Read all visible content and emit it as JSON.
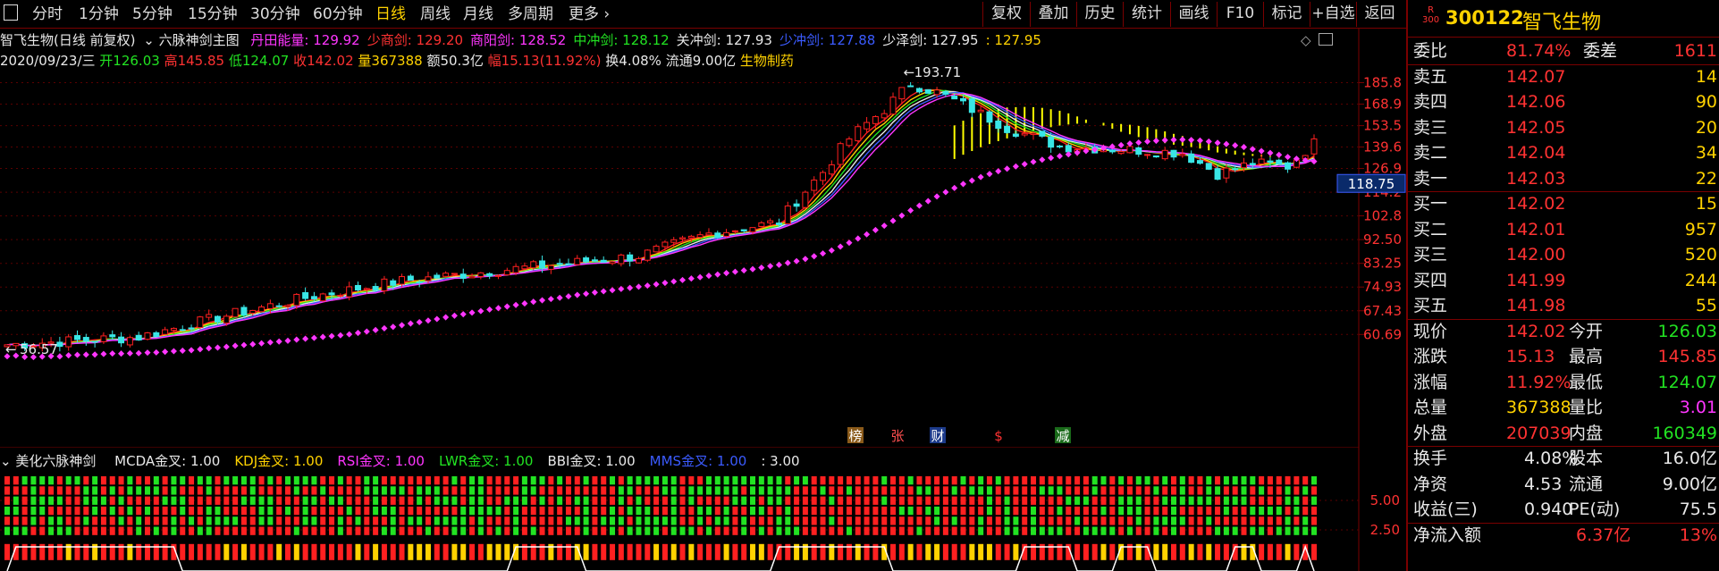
{
  "toolbar": {
    "periods": [
      "分时",
      "1分钟",
      "5分钟",
      "15分钟",
      "30分钟",
      "60分钟",
      "日线",
      "周线",
      "月线",
      "多周期",
      "更多"
    ],
    "active_period": "日线",
    "actions": [
      "复权",
      "叠加",
      "历史",
      "统计",
      "画线",
      "F10",
      "标记",
      "+自选",
      "返回"
    ]
  },
  "main_header": {
    "stock_title": "智飞生物(日线 前复权)",
    "indicator_name": "六脉神剑主图",
    "lines": [
      {
        "label": "丹田能量: 129.92",
        "color": "#ff36ff"
      },
      {
        "label": "少商剑: 129.20",
        "color": "#ff3232"
      },
      {
        "label": "商阳剑: 128.52",
        "color": "#ff36ff"
      },
      {
        "label": "中冲剑: 128.12",
        "color": "#22e322"
      },
      {
        "label": "关冲剑: 127.93",
        "color": "#e8e8e8"
      },
      {
        "label": "少冲剑: 127.88",
        "color": "#3b5bff"
      },
      {
        "label": "少泽剑: 127.95",
        "color": "#e8e8e8"
      },
      {
        "label": ": 127.95",
        "color": "#ffd200"
      }
    ],
    "date": "2020/09/23/三",
    "open": "开126.03",
    "high": "高145.85",
    "low": "低124.07",
    "close": "收142.02",
    "volume": "量367388",
    "amount": "额50.3亿",
    "change_pct": "幅15.13(11.92%)",
    "turnover": "换4.08%",
    "float_cap": "流通9.00亿",
    "industry": "生物制药"
  },
  "price_axis": {
    "labels": [
      "185.8",
      "168.9",
      "153.5",
      "139.6",
      "126.9",
      "114.2",
      "102.8",
      "92.50",
      "83.25",
      "74.93",
      "67.43",
      "60.69"
    ],
    "current_marker": "118.75"
  },
  "annotations": {
    "max_label": "193.71",
    "min_label": "56.57",
    "tags": [
      {
        "text": "榜",
        "bg": "#8a5a1a",
        "color": "#ffffff"
      },
      {
        "text": "张",
        "bg": "#000000",
        "color": "#ff5050"
      },
      {
        "text": "财",
        "bg": "#1c3a8a",
        "color": "#ffffff"
      },
      {
        "text": "$",
        "bg": "#000000",
        "color": "#ff3232"
      },
      {
        "text": "减",
        "bg": "#1a6a1a",
        "color": "#ffffff"
      }
    ]
  },
  "sub_header": {
    "name": "美化六脉神剑",
    "items": [
      {
        "label": "MCDA金叉: 1.00",
        "color": "#e8e8e8"
      },
      {
        "label": "KDJ金叉: 1.00",
        "color": "#ffd200"
      },
      {
        "label": "RSI金叉: 1.00",
        "color": "#ff36ff"
      },
      {
        "label": "LWR金叉: 1.00",
        "color": "#22e322"
      },
      {
        "label": "BBI金叉: 1.00",
        "color": "#e8e8e8"
      },
      {
        "label": "MMS金叉: 1.00",
        "color": "#3b5bff"
      },
      {
        "label": ": 3.00",
        "color": "#e8e8e8"
      }
    ],
    "axis_labels": [
      "5.00",
      "2.50"
    ]
  },
  "quote": {
    "badge": "R\n300",
    "code": "300122",
    "name": "智飞生物",
    "weibi_label": "委比",
    "weibi_value": "81.74%",
    "weicha_label": "委差",
    "weicha_value": "1611",
    "asks": [
      {
        "label": "卖五",
        "price": "142.07",
        "vol": "14"
      },
      {
        "label": "卖四",
        "price": "142.06",
        "vol": "90"
      },
      {
        "label": "卖三",
        "price": "142.05",
        "vol": "20"
      },
      {
        "label": "卖二",
        "price": "142.04",
        "vol": "34"
      },
      {
        "label": "卖一",
        "price": "142.03",
        "vol": "22"
      }
    ],
    "bids": [
      {
        "label": "买一",
        "price": "142.02",
        "vol": "15"
      },
      {
        "label": "买二",
        "price": "142.01",
        "vol": "957"
      },
      {
        "label": "买三",
        "price": "142.00",
        "vol": "520"
      },
      {
        "label": "买四",
        "price": "141.99",
        "vol": "244"
      },
      {
        "label": "买五",
        "price": "141.98",
        "vol": "55"
      }
    ],
    "stats": [
      {
        "l1": "现价",
        "v1": "142.02",
        "c1": "#ff3232",
        "l2": "今开",
        "v2": "126.03",
        "c2": "#22e322"
      },
      {
        "l1": "涨跌",
        "v1": "15.13",
        "c1": "#ff3232",
        "l2": "最高",
        "v2": "145.85",
        "c2": "#ff3232"
      },
      {
        "l1": "涨幅",
        "v1": "11.92%",
        "c1": "#ff3232",
        "l2": "最低",
        "v2": "124.07",
        "c2": "#22e322"
      },
      {
        "l1": "总量",
        "v1": "367388",
        "c1": "#ffd200",
        "l2": "量比",
        "v2": "3.01",
        "c2": "#ff36ff"
      },
      {
        "l1": "外盘",
        "v1": "207039",
        "c1": "#ff3232",
        "l2": "内盘",
        "v2": "160349",
        "c2": "#22e322"
      }
    ],
    "stats2": [
      {
        "l1": "换手",
        "v1": "4.08%",
        "c1": "#e8e8e8",
        "l2": "股本",
        "v2": "16.0亿",
        "c2": "#e8e8e8"
      },
      {
        "l1": "净资",
        "v1": "4.53",
        "c1": "#e8e8e8",
        "l2": "流通",
        "v2": "9.00亿",
        "c2": "#e8e8e8"
      },
      {
        "l1": "收益(三)",
        "v1": "0.940",
        "c1": "#e8e8e8",
        "l2": "PE(动)",
        "v2": "75.5",
        "c2": "#e8e8e8"
      }
    ],
    "net_inflow_label": "净流入额",
    "net_inflow_value": "6.37亿",
    "net_inflow_pct": "13%"
  },
  "chart_data": {
    "type": "candlestick",
    "title": "智飞生物(日线 前复权)",
    "ylim": [
      56.57,
      193.71
    ],
    "y_scale": "log",
    "last_close": 142.02,
    "max_high": 193.71,
    "min_low": 56.57
  }
}
